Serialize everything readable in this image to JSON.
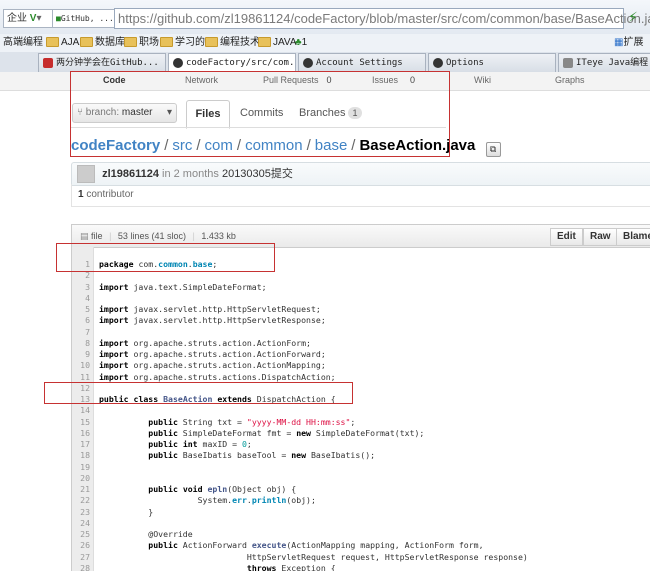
{
  "browser": {
    "mode_label": "企业",
    "mode_icon": "v-logo-icon",
    "site_combo": "GitHub, ...",
    "url": "https://github.com/zl19861124/codeFactory/blob/master/src/com/common/base/BaseAction.java",
    "bookmarks": [
      "高端编程",
      "AJAX",
      "数据库",
      "职场",
      "学习的",
      "编程技术",
      "JAVA",
      "1"
    ],
    "extend_label": "扩展",
    "tabs": [
      {
        "title": "两分钟学会在GitHub...",
        "icon": "red-site-icon",
        "active": false
      },
      {
        "title": "codeFactory/src/com...",
        "icon": "github-icon",
        "active": true
      },
      {
        "title": "Account Settings",
        "icon": "github-icon",
        "active": false
      },
      {
        "title": "Options",
        "icon": "github-icon",
        "active": false
      },
      {
        "title": "ITeye Java编程 Spr",
        "icon": "iteye-icon",
        "active": false
      }
    ]
  },
  "repo_nav": {
    "items": [
      {
        "label": "Code",
        "count": ""
      },
      {
        "label": "Network",
        "count": ""
      },
      {
        "label": "Pull Requests",
        "count": "0"
      },
      {
        "label": "Issues",
        "count": "0"
      },
      {
        "label": "Wiki",
        "count": ""
      },
      {
        "label": "Graphs",
        "count": ""
      }
    ]
  },
  "branch": {
    "prefix": "branch:",
    "name": "master"
  },
  "subtabs": {
    "files": "Files",
    "commits": "Commits",
    "branches": "Branches",
    "branches_count": "1"
  },
  "breadcrumb": {
    "root": "codeFactory",
    "parts": [
      "src",
      "com",
      "common",
      "base"
    ],
    "file": "BaseAction.java"
  },
  "commit": {
    "author": "zl19861124",
    "time": "in 2 months",
    "message": "20130305提交"
  },
  "contributors": {
    "count": "1",
    "label": "contributor"
  },
  "file_info": {
    "type": "file",
    "lines": "53 lines (41 sloc)",
    "size": "1.433 kb",
    "buttons": [
      "Edit",
      "Raw",
      "Blame"
    ]
  },
  "code_lines": [
    {
      "n": "1",
      "html": "<span class=\"kw\">package</span> com.<span class=\"ns\">common</span>.<span class=\"ns\">base</span>;"
    },
    {
      "n": "2",
      "html": ""
    },
    {
      "n": "3",
      "html": "<span class=\"kw\">import</span> java.text.SimpleDateFormat;"
    },
    {
      "n": "4",
      "html": ""
    },
    {
      "n": "5",
      "html": "<span class=\"kw\">import</span> javax.servlet.http.HttpServletRequest;"
    },
    {
      "n": "6",
      "html": "<span class=\"kw\">import</span> javax.servlet.http.HttpServletResponse;"
    },
    {
      "n": "7",
      "html": ""
    },
    {
      "n": "8",
      "html": "<span class=\"kw\">import</span> org.apache.struts.action.ActionForm;"
    },
    {
      "n": "9",
      "html": "<span class=\"kw\">import</span> org.apache.struts.action.ActionForward;"
    },
    {
      "n": "10",
      "html": "<span class=\"kw\">import</span> org.apache.struts.action.ActionMapping;"
    },
    {
      "n": "11",
      "html": "<span class=\"kw\">import</span> org.apache.struts.actions.DispatchAction;"
    },
    {
      "n": "12",
      "html": ""
    },
    {
      "n": "13",
      "html": "<span class=\"kw\">public</span> <span class=\"kw\">class</span> <span class=\"cls\">BaseAction</span> <span class=\"kw\">extends</span> DispatchAction {"
    },
    {
      "n": "14",
      "html": ""
    },
    {
      "n": "15",
      "html": "          <span class=\"kw\">public</span> String txt = <span class=\"str\">\"yyyy-MM-dd HH:mm:ss\"</span>;"
    },
    {
      "n": "16",
      "html": "          <span class=\"kw\">public</span> SimpleDateFormat fmt = <span class=\"kw\">new</span> SimpleDateFormat(txt);"
    },
    {
      "n": "17",
      "html": "          <span class=\"kw\">public</span> <span class=\"kw\">int</span> maxID = <span class=\"num\">0</span>;"
    },
    {
      "n": "18",
      "html": "          <span class=\"kw\">public</span> BaseIbatis baseTool = <span class=\"kw\">new</span> BaseIbatis();"
    },
    {
      "n": "19",
      "html": ""
    },
    {
      "n": "20",
      "html": ""
    },
    {
      "n": "21",
      "html": "          <span class=\"kw\">public</span> <span class=\"kw\">void</span> <span class=\"cls\">epln</span>(Object obj) {"
    },
    {
      "n": "22",
      "html": "                    System.<span class=\"ns\">err</span>.<span class=\"ns\">println</span>(obj);"
    },
    {
      "n": "23",
      "html": "          }"
    },
    {
      "n": "24",
      "html": ""
    },
    {
      "n": "25",
      "html": "          @Override"
    },
    {
      "n": "26",
      "html": "          <span class=\"kw\">public</span> ActionForward <span class=\"cls\">execute</span>(ActionMapping mapping, ActionForm form,"
    },
    {
      "n": "27",
      "html": "                              HttpServletRequest request, HttpServletResponse response)"
    },
    {
      "n": "28",
      "html": "                              <span class=\"kw\">throws</span> Exception {"
    }
  ],
  "colors": {
    "link": "#4183c4",
    "annotation": "#c63232"
  }
}
